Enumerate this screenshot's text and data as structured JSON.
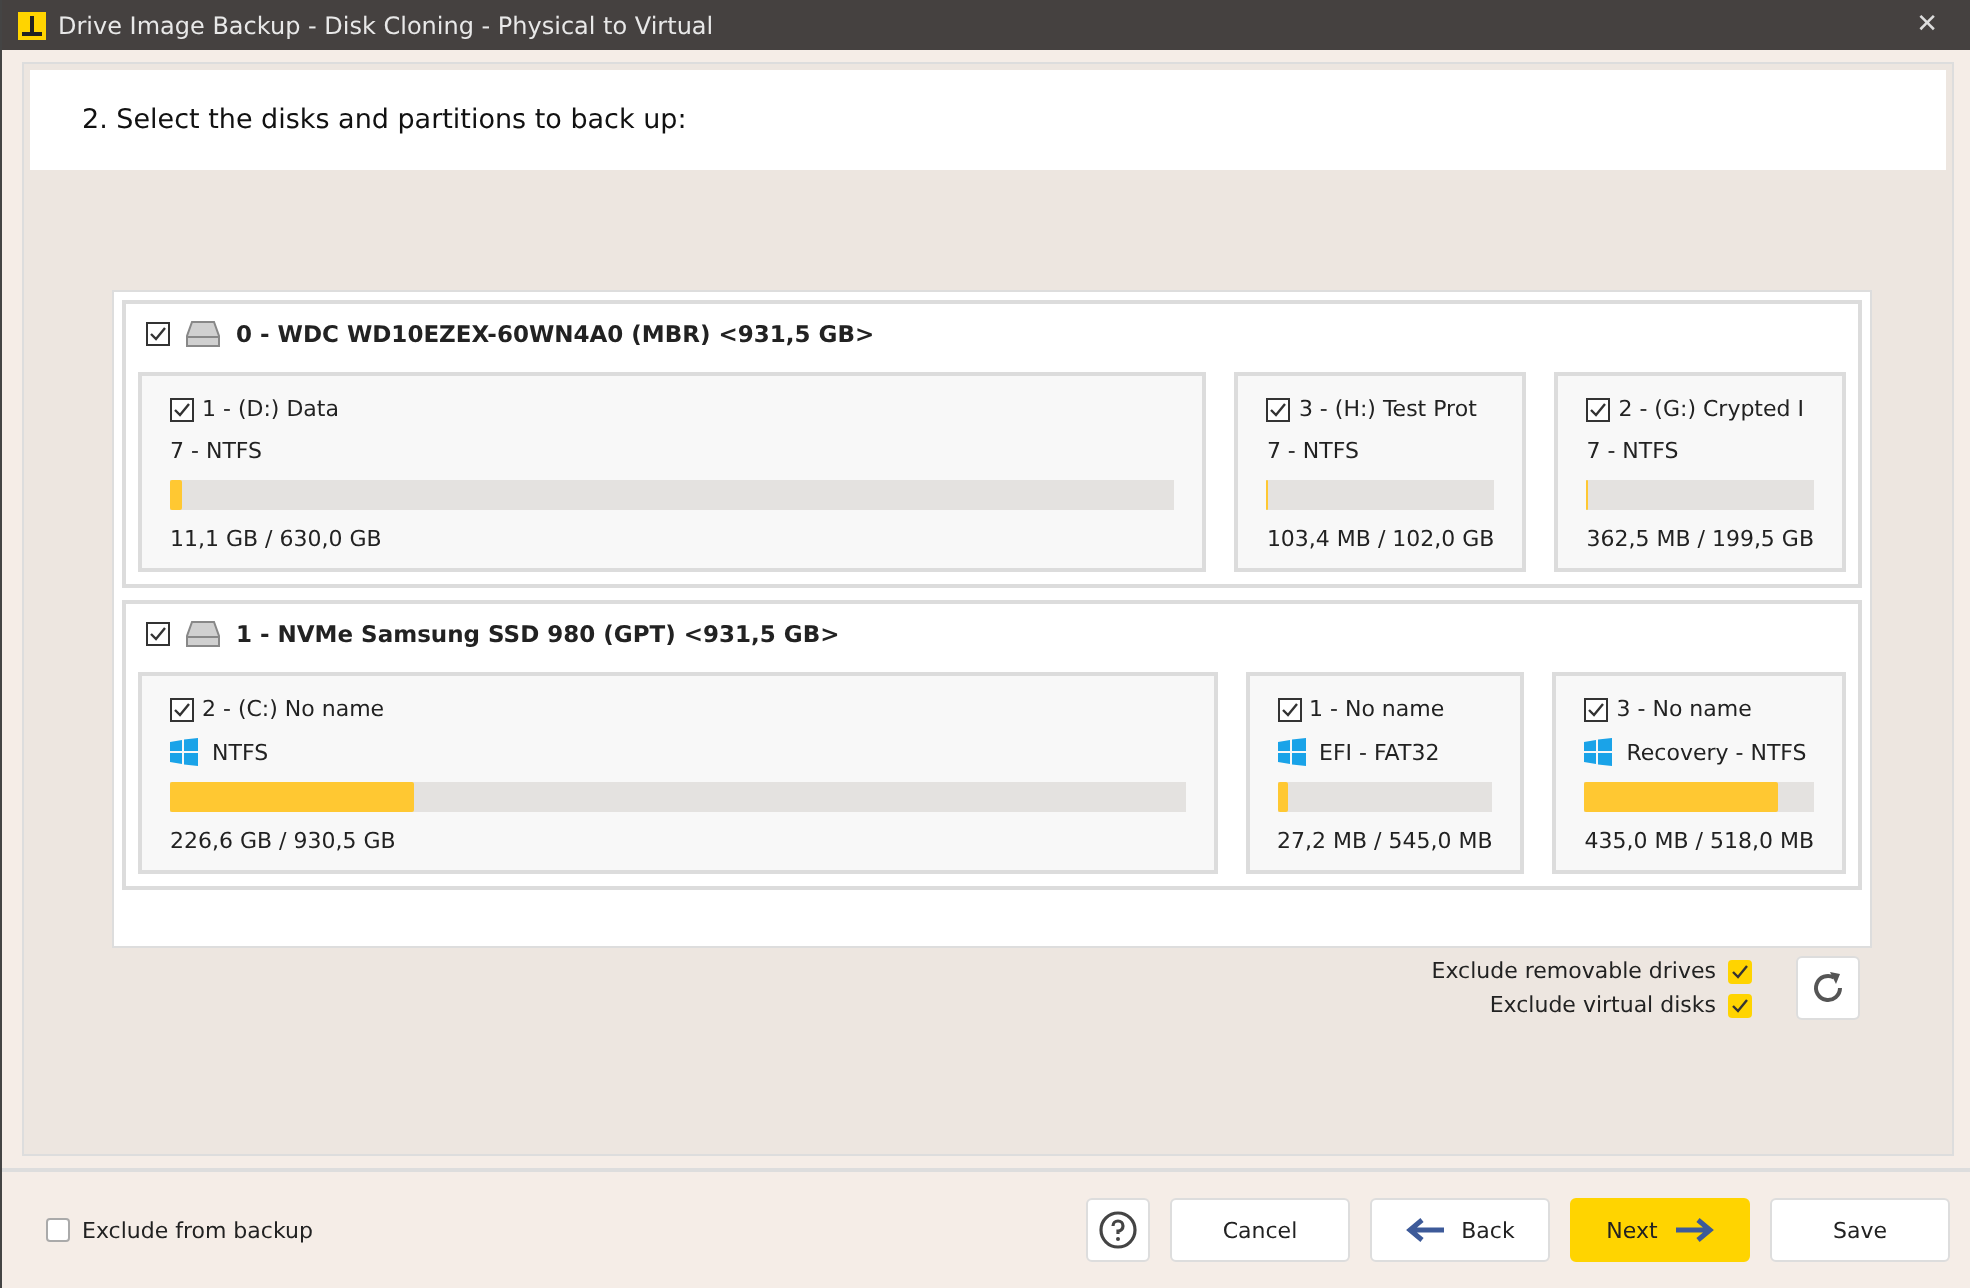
{
  "window": {
    "title": "Drive Image Backup - Disk Cloning - Physical to Virtual",
    "close": "✕"
  },
  "step_title": "2. Select the disks and partitions to back up:",
  "disks": [
    {
      "label": "0 - WDC WD10EZEX-60WN4A0 (MBR) <931,5 GB>",
      "checked": true,
      "partitions": [
        {
          "label": "1 - (D:) Data",
          "checked": true,
          "windows": false,
          "fs": "7 - NTFS",
          "level": 0.012,
          "usage": "11,1 GB / 630,0 GB"
        },
        {
          "label": "3 - (H:) Test Prot",
          "checked": true,
          "windows": false,
          "fs": "7 - NTFS",
          "level": 0.001,
          "usage": "103,4 MB / 102,0 GB"
        },
        {
          "label": "2 - (G:) Crypted I",
          "checked": true,
          "windows": false,
          "fs": "7 - NTFS",
          "level": 0.002,
          "usage": "362,5 MB / 199,5 GB"
        }
      ]
    },
    {
      "label": "1 - NVMe Samsung SSD 980 (GPT) <931,5 GB>",
      "checked": true,
      "partitions": [
        {
          "label": "2 - (C:) No name",
          "checked": true,
          "windows": true,
          "fs": "NTFS",
          "level": 0.24,
          "usage": "226,6 GB / 930,5 GB"
        },
        {
          "label": "1 -  No name",
          "checked": true,
          "windows": true,
          "fs": "EFI - FAT32",
          "level": 0.05,
          "usage": "27,2 MB / 545,0 MB"
        },
        {
          "label": "3 -  No name",
          "checked": true,
          "windows": true,
          "fs": "Recovery - NTFS",
          "level": 0.84,
          "usage": "435,0 MB / 518,0 MB"
        }
      ]
    }
  ],
  "options": [
    {
      "label": "Exclude removable drives",
      "checked": true
    },
    {
      "label": "Exclude virtual disks",
      "checked": true
    }
  ],
  "exclude_from_backup": {
    "label": "Exclude from backup",
    "checked": false
  },
  "buttons": [
    {
      "kind": "help"
    },
    {
      "kind": "plain",
      "label": "Cancel"
    },
    {
      "kind": "back",
      "label": "Back"
    },
    {
      "kind": "next",
      "label": "Next"
    },
    {
      "kind": "plain",
      "label": "Save"
    }
  ]
}
